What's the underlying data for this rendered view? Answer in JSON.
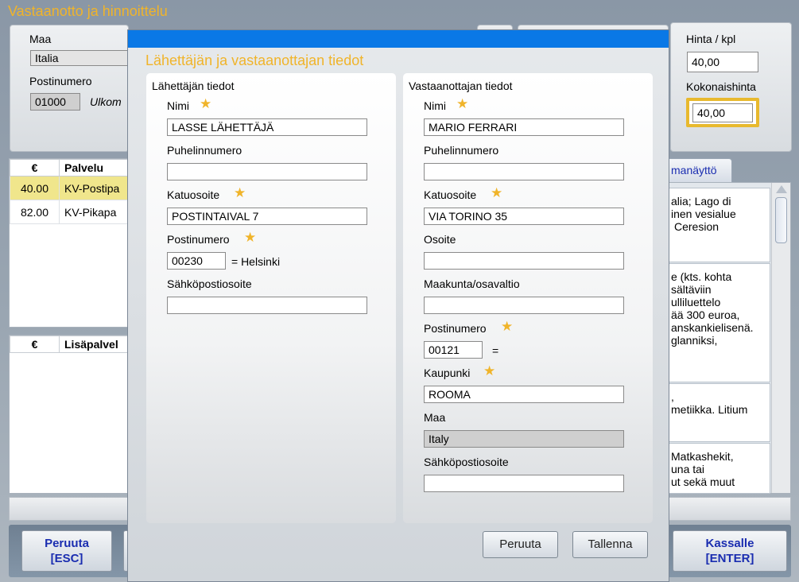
{
  "app": {
    "title": "Vastaanotto ja hinnoittelu"
  },
  "country_panel": {
    "maa_label": "Maa",
    "maa_value": "Italia",
    "postinumero_label": "Postinumero",
    "postinumero_value": "01000",
    "postinumero_hint": "Ulkom"
  },
  "price_panel": {
    "hinta_label": "Hinta / kpl",
    "hinta_value": "40,00",
    "kokonaishinta_label": "Kokonaishinta",
    "kokonaishinta_value": "40,00"
  },
  "services": {
    "headers": [
      "€",
      "Palvelu"
    ],
    "rows": [
      {
        "price": "40.00",
        "name": "KV-Postipa"
      },
      {
        "price": "82.00",
        "name": "KV-Pikapa"
      }
    ]
  },
  "extras": {
    "headers": [
      "€",
      "Lisäpalvel"
    ]
  },
  "info": {
    "tab_label": "manäyttö",
    "blocks": [
      {
        "lines": [
          "alia; Lago di",
          "inen vesialue",
          "Ceresion"
        ]
      },
      {
        "lines": [
          "e (kts. kohta",
          "sältäviin",
          "ulliluettelo",
          "ää 300 euroa,",
          "anskankielisenä.",
          "glanniksi,"
        ]
      },
      {
        "lines": [
          ",",
          "metiikka. Litium"
        ]
      },
      {
        "lines": [
          "Matkashekit,",
          "una tai",
          "ut sekä muut"
        ]
      }
    ]
  },
  "bottom_buttons": {
    "peruuta_line1": "Peruuta",
    "peruuta_line2": "[ESC]",
    "kassalle_line1": "Kassalle",
    "kassalle_line2": "[ENTER]"
  },
  "dialog": {
    "title": "Lähettäjän ja vastaanottajan tiedot",
    "sender": {
      "heading": "Lähettäjän tiedot",
      "nimi_label": "Nimi",
      "nimi_value": "LASSE LÄHETTÄJÄ",
      "puhelin_label": "Puhelinnumero",
      "puhelin_value": "",
      "katuosoite_label": "Katuosoite",
      "katuosoite_value": "POSTINTAIVAL 7",
      "postinumero_label": "Postinumero",
      "postinumero_value": "00230",
      "city_text": "= Helsinki",
      "email_label": "Sähköpostiosoite",
      "email_value": ""
    },
    "receiver": {
      "heading": "Vastaanottajan tiedot",
      "nimi_label": "Nimi",
      "nimi_value": "MARIO FERRARI",
      "puhelin_label": "Puhelinnumero",
      "puhelin_value": "",
      "katuosoite_label": "Katuosoite",
      "katuosoite_value": "VIA TORINO 35",
      "osoite_label": "Osoite",
      "osoite_value": "",
      "maakunta_label": "Maakunta/osavaltio",
      "maakunta_value": "",
      "postinumero_label": "Postinumero",
      "postinumero_value": "00121",
      "equals_text": "=",
      "kaupunki_label": "Kaupunki",
      "kaupunki_value": "ROOMA",
      "maa_label": "Maa",
      "maa_value": "Italy",
      "email_label": "Sähköpostiosoite",
      "email_value": ""
    },
    "cancel_label": "Peruuta",
    "save_label": "Tallenna"
  },
  "colors": {
    "accent_title": "#f0b42a",
    "dialog_bar": "#0a78e6",
    "highlight_row": "#f0e68c",
    "button_text": "#1a2db0"
  }
}
